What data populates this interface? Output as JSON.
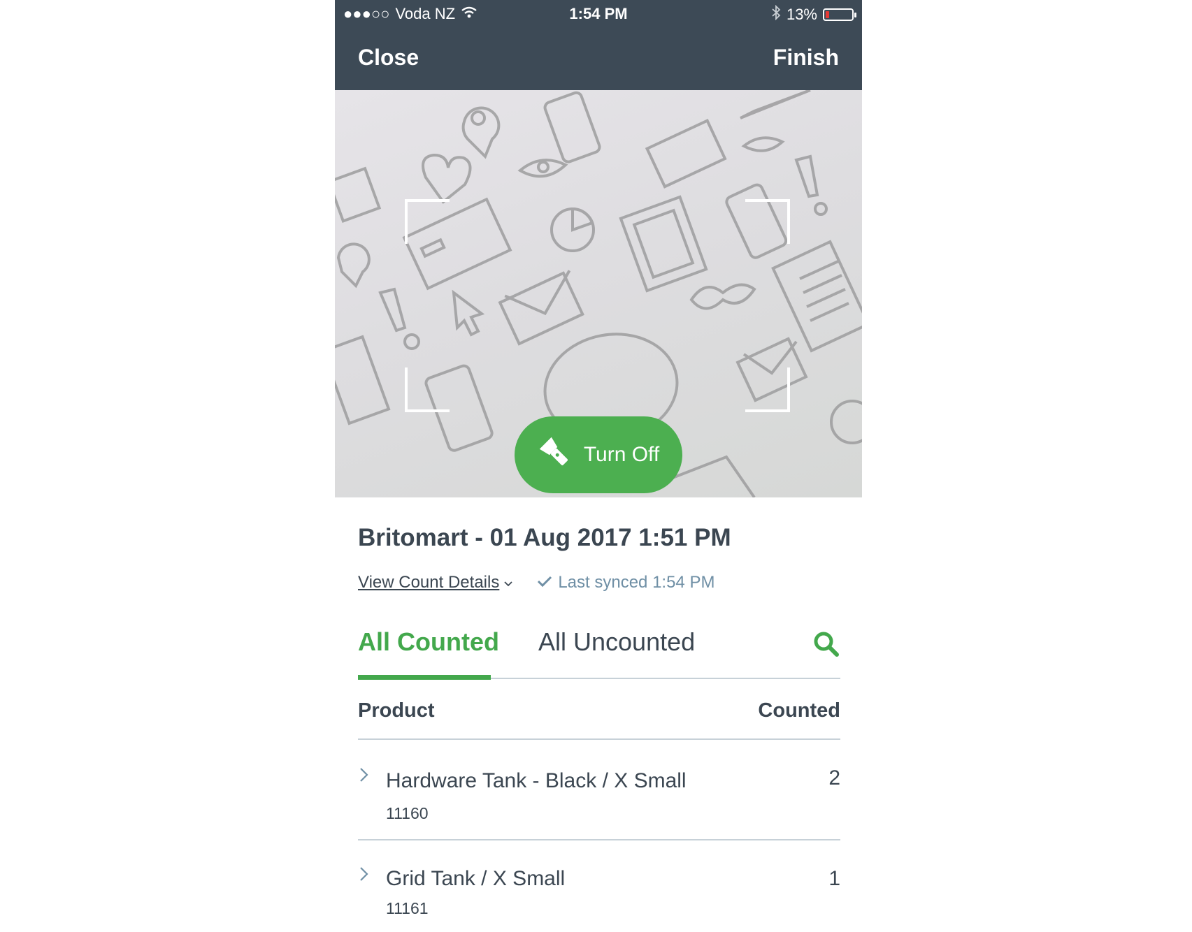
{
  "status_bar": {
    "carrier": "Voda NZ",
    "signal_dots": "●●●○○",
    "time": "1:54 PM",
    "battery_percent": "13%",
    "battery_level": 0.13,
    "icons": [
      "wifi-icon",
      "bluetooth-icon",
      "battery-icon"
    ]
  },
  "nav": {
    "close_label": "Close",
    "finish_label": "Finish"
  },
  "camera": {
    "torch_label": "Turn Off",
    "torch_icon": "flashlight-icon"
  },
  "count": {
    "title": "Britomart - 01 Aug 2017 1:51 PM",
    "details_link": "View Count Details",
    "sync_status": "Last synced 1:54 PM"
  },
  "tabs": [
    {
      "label": "All Counted",
      "active": true
    },
    {
      "label": "All Uncounted",
      "active": false
    }
  ],
  "table": {
    "headers": {
      "product": "Product",
      "counted": "Counted"
    },
    "rows": [
      {
        "name": "Hardware Tank - Black / X Small",
        "sku": "11160",
        "counted": "2"
      },
      {
        "name": "Grid Tank / X Small",
        "sku": "11161",
        "counted": "1"
      }
    ]
  },
  "colors": {
    "header_bg": "#3d4a56",
    "accent_green": "#43a84c",
    "text_dark": "#3b4651",
    "text_muted": "#6f8fa5"
  }
}
